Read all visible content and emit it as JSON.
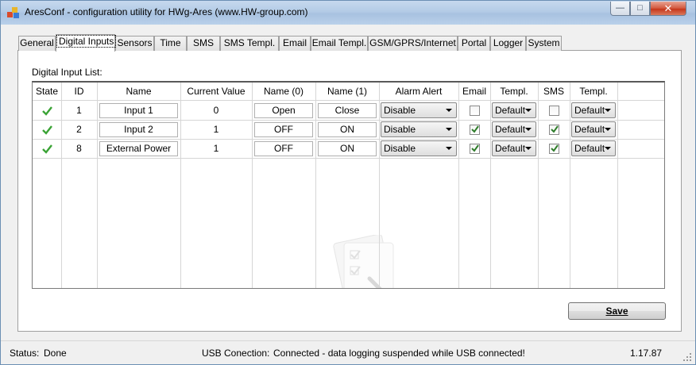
{
  "window": {
    "title": "AresConf - configuration utility for HWg-Ares (www.HW-group.com)",
    "buttons": {
      "minimize": "—",
      "maximize": "□",
      "close": "✕"
    }
  },
  "tabs": [
    "General",
    "Digital Inputs",
    "Sensors",
    "Time",
    "SMS",
    "SMS Templ.",
    "Email",
    "Email Templ.",
    "GSM/GPRS/Internet",
    "Portal",
    "Logger",
    "System"
  ],
  "active_tab": "Digital Inputs",
  "digital_inputs": {
    "list_label": "Digital Input List:",
    "columns": [
      "State",
      "ID",
      "Name",
      "Current Value",
      "Name (0)",
      "Name (1)",
      "Alarm Alert",
      "Email",
      "Templ.",
      "SMS",
      "Templ."
    ],
    "rows": [
      {
        "state": "ok",
        "id": "1",
        "name": "Input 1",
        "current_value": "0",
        "name0": "Open",
        "name1": "Close",
        "alarm_alert": "Disable",
        "email": false,
        "email_templ": "Default",
        "sms": false,
        "sms_templ": "Default"
      },
      {
        "state": "ok",
        "id": "2",
        "name": "Input 2",
        "current_value": "1",
        "name0": "OFF",
        "name1": "ON",
        "alarm_alert": "Disable",
        "email": true,
        "email_templ": "Default",
        "sms": true,
        "sms_templ": "Default"
      },
      {
        "state": "ok",
        "id": "8",
        "name": "External Power",
        "current_value": "1",
        "name0": "OFF",
        "name1": "ON",
        "alarm_alert": "Disable",
        "email": true,
        "email_templ": "Default",
        "sms": true,
        "sms_templ": "Default"
      }
    ],
    "save_label": "Save"
  },
  "statusbar": {
    "status_label": "Status:",
    "status_value": "Done",
    "usb_label": "USB Conection:",
    "usb_value": "Connected - data logging suspended while USB connected!",
    "version": "1.17.87"
  },
  "colors": {
    "state_ok": "#3aa335",
    "check": "#2e7d2a",
    "close_button": "#c6361a"
  }
}
